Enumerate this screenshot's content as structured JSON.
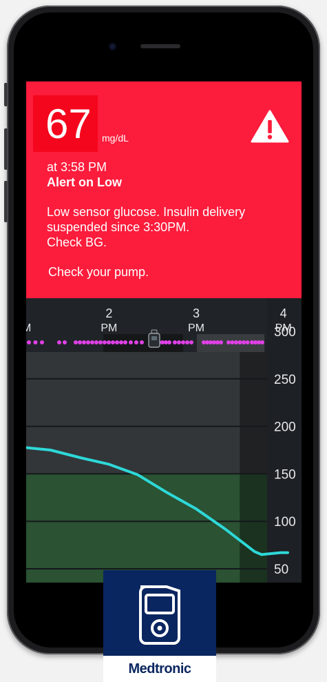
{
  "alert": {
    "glucose_value": "67",
    "glucose_unit": "mg/dL",
    "time": "at 3:58 PM",
    "title": "Alert on Low",
    "message_lines": [
      "Low sensor glucose. Insulin delivery",
      "suspended since 3:30PM.",
      "Check BG."
    ],
    "pump_message": "Check your pump.",
    "icon": "warning-triangle-icon",
    "colors": {
      "background": "#fc1c3c",
      "glucose_box": "#f4061c"
    }
  },
  "brand": {
    "name": "Medtronic",
    "icon": "insulin-pump-icon",
    "color": "#0a2660"
  },
  "chart_data": {
    "type": "line",
    "x_ticks": [
      {
        "hour": "2",
        "period": "PM"
      },
      {
        "hour": "3",
        "period": "PM"
      },
      {
        "hour": "4",
        "period": "PM"
      }
    ],
    "x_tick_partial": "M",
    "x_domain_hours": [
      13.05,
      16.05
    ],
    "y_ticks": [
      300,
      250,
      200,
      150,
      100,
      50
    ],
    "ylim": [
      50,
      300
    ],
    "target_range": [
      50,
      150
    ],
    "suspend_start_hour": 15.5,
    "series": [
      {
        "color": "#2ed8d8",
        "x": [
          13.0,
          13.33,
          13.67,
          14.0,
          14.33,
          14.67,
          15.0,
          15.33,
          15.67,
          15.75,
          15.97,
          16.05
        ],
        "y": [
          178,
          175,
          167,
          160,
          149,
          130,
          113,
          92,
          68,
          65,
          67,
          67
        ]
      }
    ],
    "legend": null
  }
}
